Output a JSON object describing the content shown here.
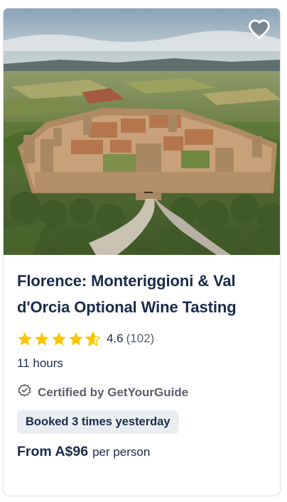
{
  "card": {
    "image_alt": "Aerial view of the walled medieval town of Monteriggioni",
    "wishlist_icon": "heart-outline-icon",
    "title": "Florence: Monteriggioni & Val d'Orcia Optional Wine Tasting",
    "rating": {
      "value": "4.6",
      "count": "(102)",
      "stars": 4.6,
      "star_color": "#fdc500"
    },
    "duration": "11 hours",
    "certified": {
      "icon": "shield-check-icon",
      "label": "Certified by GetYourGuide"
    },
    "badge": "Booked 3 times yesterday",
    "price": {
      "amount": "From A$96",
      "suffix": "per person"
    }
  },
  "colors": {
    "text": "#1a2b49",
    "muted": "#585f6b",
    "badge_bg": "#ebeef1",
    "border": "#dcdfe4"
  }
}
